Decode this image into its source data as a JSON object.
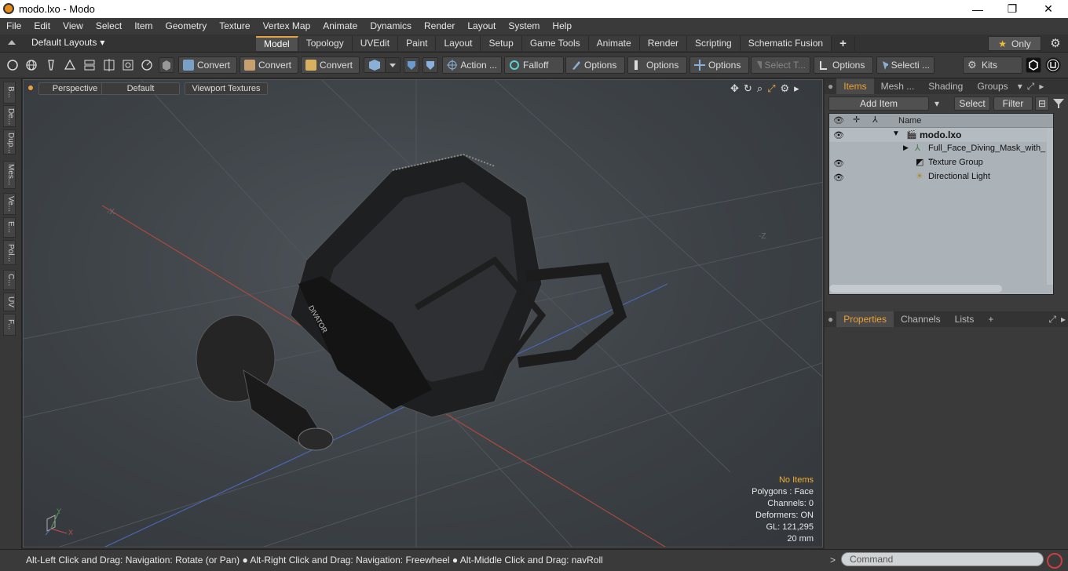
{
  "window": {
    "title": "modo.lxo - Modo",
    "minimize": "—",
    "maximize": "❐",
    "close": "✕"
  },
  "menu": [
    "File",
    "Edit",
    "View",
    "Select",
    "Item",
    "Geometry",
    "Texture",
    "Vertex Map",
    "Animate",
    "Dynamics",
    "Render",
    "Layout",
    "System",
    "Help"
  ],
  "layout": {
    "selector": "Default Layouts",
    "tabs": [
      "Model",
      "Topology",
      "UVEdit",
      "Paint",
      "Layout",
      "Setup",
      "Game Tools",
      "Animate",
      "Render",
      "Scripting",
      "Schematic Fusion"
    ],
    "active_tab": "Model",
    "only_label": "Only",
    "add_tab": "+"
  },
  "toolbar": {
    "convert1": "Convert",
    "convert2": "Convert",
    "convert3": "Convert",
    "action": "Action  ...",
    "falloff": "Falloff",
    "options1": "Options",
    "options2": "Options",
    "options3": "Options",
    "select_t": "Select T...",
    "options4": "Options",
    "selecti": "Selecti ...",
    "kits": "Kits"
  },
  "left_tabs": [
    "B...",
    "De...",
    "Dup...",
    "Mes...",
    "Ve...",
    "E...",
    "Pol...",
    "C...",
    "UV",
    "F..."
  ],
  "viewport": {
    "view_mode": "Perspective",
    "shading": "Default",
    "textures": "Viewport Textures",
    "axis_labels": {
      "y": "Y",
      "x": "X",
      "neg_x": "-X",
      "neg_z": "-Z"
    },
    "info": {
      "selection": "No Items",
      "polygons": "Polygons : Face",
      "channels": "Channels: 0",
      "deformers": "Deformers: ON",
      "gl": "GL: 121,295",
      "scale": "20 mm"
    },
    "model_label": "DIVATOR"
  },
  "items_panel": {
    "tabs": [
      "Items",
      "Mesh ...",
      "Shading",
      "Groups"
    ],
    "active_tab": "Items",
    "add_item": "Add Item",
    "select": "Select",
    "filter": "Filter",
    "column_name": "Name",
    "rows": [
      {
        "name": "modo.lxo",
        "visible": true,
        "bold": true
      },
      {
        "name": "Full_Face_Diving_Mask_with_ ...",
        "visible": false
      },
      {
        "name": "Texture Group",
        "visible": true
      },
      {
        "name": "Directional Light",
        "visible": true
      }
    ]
  },
  "properties_panel": {
    "tabs": [
      "Properties",
      "Channels",
      "Lists"
    ],
    "active_tab": "Properties",
    "add": "+"
  },
  "status": {
    "hint": "Alt-Left Click and Drag: Navigation: Rotate (or Pan) ● Alt-Right Click and Drag: Navigation: Freewheel ● Alt-Middle Click and Drag: navRoll",
    "command_placeholder": "Command",
    "prompt": ">"
  },
  "colors": {
    "accent": "#f0a030",
    "grid_red": "#b04a3a",
    "grid_blue": "#4a6ab8"
  }
}
